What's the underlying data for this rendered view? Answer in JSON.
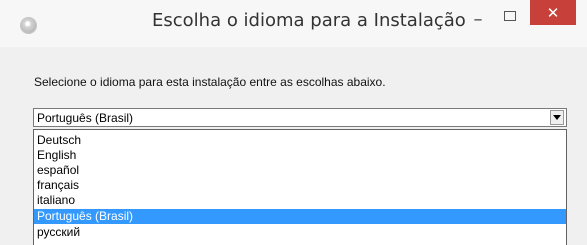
{
  "window": {
    "title": "Escolha o idioma para a Instalação",
    "minimize_glyph": "–",
    "close_glyph": "✕",
    "accent_close": "#c7403a"
  },
  "dialog": {
    "instruction": "Selecione o idioma para esta instalação entre as escolhas abaixo.",
    "selected_language": "Português (Brasil)",
    "options": [
      "Deutsch",
      "English",
      "español",
      "français",
      "italiano",
      "Português (Brasil)",
      "русский"
    ],
    "highlight_color": "#3399ff"
  }
}
